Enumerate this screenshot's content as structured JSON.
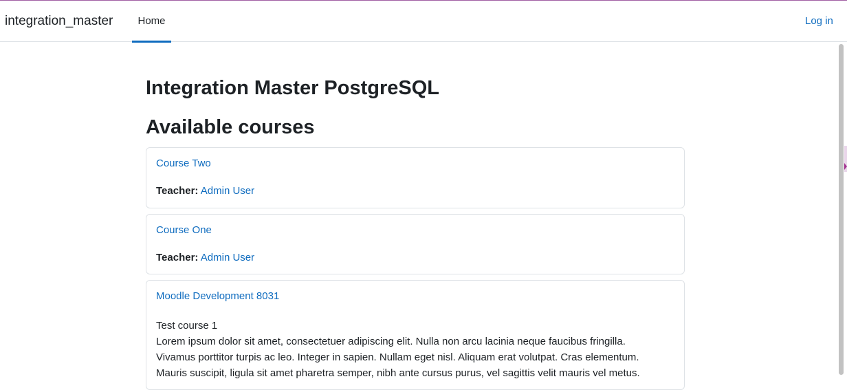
{
  "header": {
    "site_name": "integration_master",
    "nav": {
      "home_label": "Home"
    },
    "login_label": "Log in"
  },
  "main": {
    "page_title": "Integration Master PostgreSQL",
    "section_title": "Available courses",
    "courses": [
      {
        "name": "Course Two",
        "teacher_label": "Teacher:",
        "teacher_name": "Admin User"
      },
      {
        "name": "Course One",
        "teacher_label": "Teacher:",
        "teacher_name": "Admin User"
      },
      {
        "name": "Moodle Development 8031",
        "summary_lines": [
          "Test course 1",
          "Lorem ipsum dolor sit amet, consectetuer adipiscing elit. Nulla non arcu lacinia neque faucibus fringilla.",
          "Vivamus porttitor turpis ac leo. Integer in sapien. Nullam eget nisl. Aliquam erat volutpat. Cras elementum.",
          "Mauris suscipit, ligula sit amet pharetra semper, nibh ante cursus purus, vel sagittis velit mauris vel metus."
        ]
      }
    ]
  },
  "colors": {
    "accent": "#0f6cbf",
    "text": "#1d2125",
    "border": "#dee2e6",
    "top_strip": "#a15fa4"
  }
}
